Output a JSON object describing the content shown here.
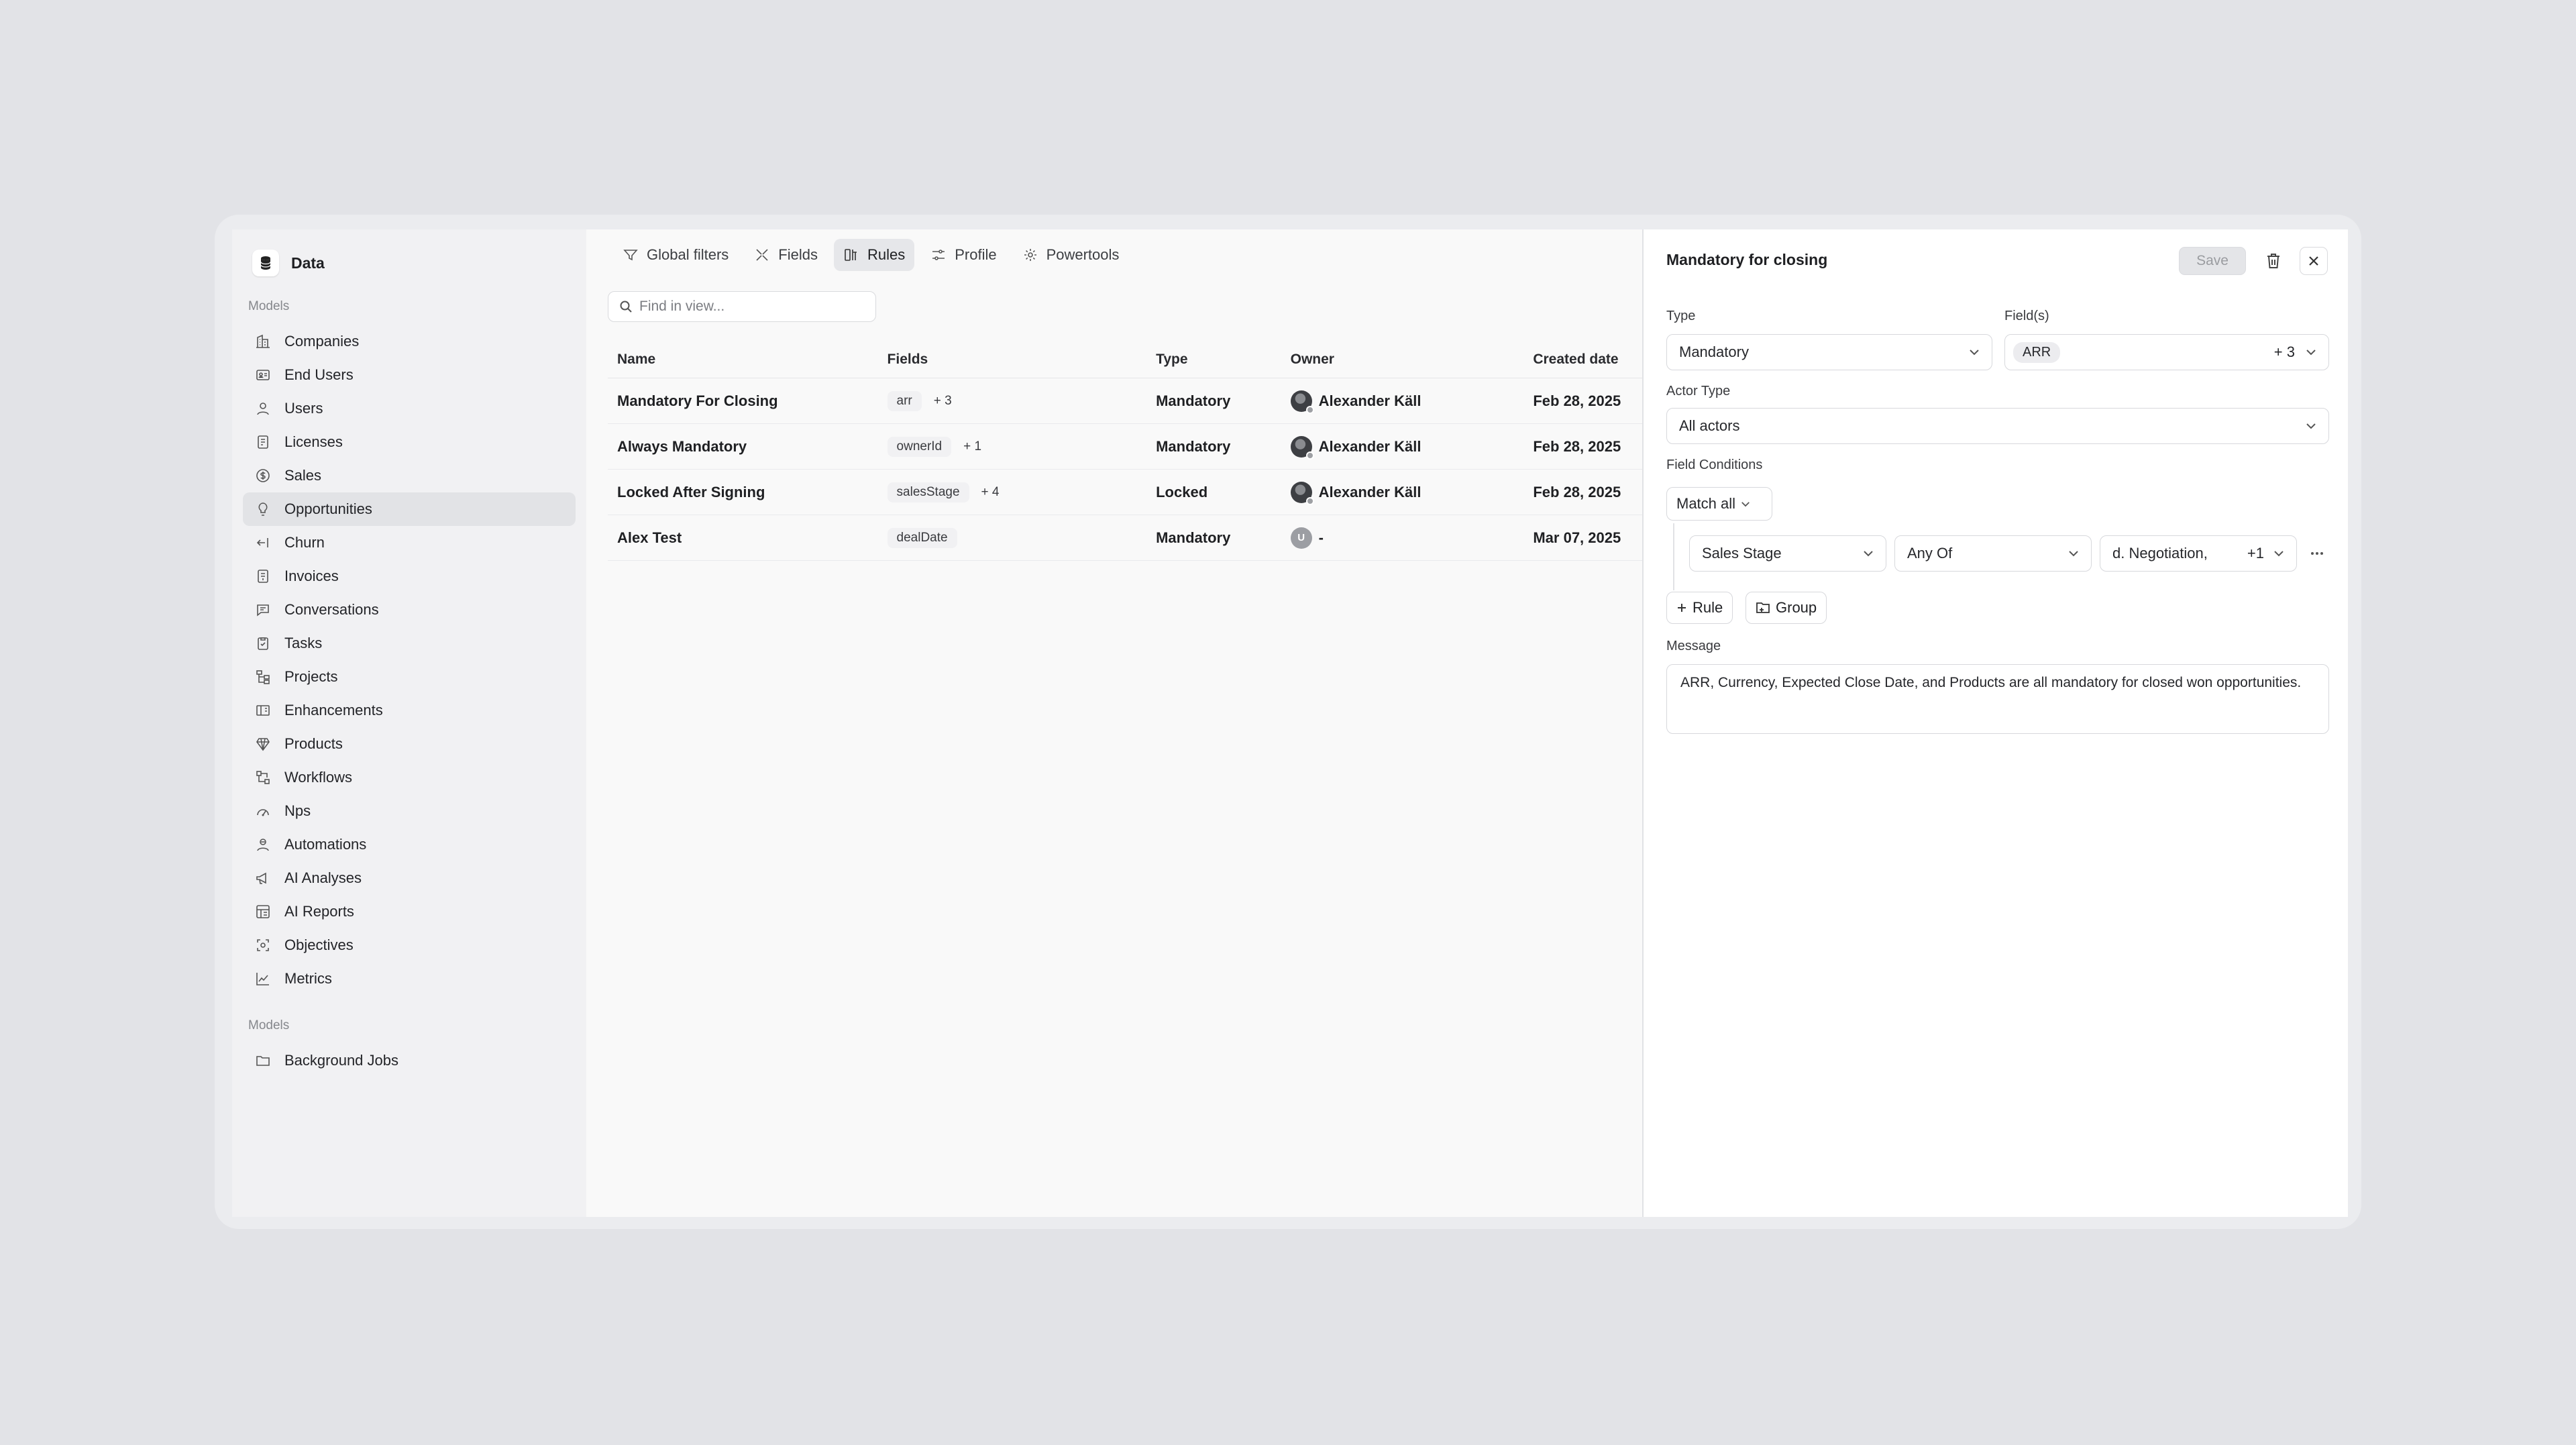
{
  "sidebar": {
    "title": "Data",
    "section_models": "Models",
    "items": [
      {
        "label": "Companies",
        "icon": "building-icon"
      },
      {
        "label": "End Users",
        "icon": "id-card-icon"
      },
      {
        "label": "Users",
        "icon": "user-icon"
      },
      {
        "label": "Licenses",
        "icon": "license-icon"
      },
      {
        "label": "Sales",
        "icon": "dollar-circle-icon"
      },
      {
        "label": "Opportunities",
        "icon": "lightbulb-icon"
      },
      {
        "label": "Churn",
        "icon": "arrow-left-exit-icon"
      },
      {
        "label": "Invoices",
        "icon": "invoice-icon"
      },
      {
        "label": "Conversations",
        "icon": "chat-icon"
      },
      {
        "label": "Tasks",
        "icon": "clipboard-check-icon"
      },
      {
        "label": "Projects",
        "icon": "hierarchy-icon"
      },
      {
        "label": "Enhancements",
        "icon": "columns-icon"
      },
      {
        "label": "Products",
        "icon": "gem-icon"
      },
      {
        "label": "Workflows",
        "icon": "workflow-icon"
      },
      {
        "label": "Nps",
        "icon": "gauge-icon"
      },
      {
        "label": "Automations",
        "icon": "robot-user-icon"
      },
      {
        "label": "AI Analyses",
        "icon": "megaphone-icon"
      },
      {
        "label": "AI Reports",
        "icon": "report-grid-icon"
      },
      {
        "label": "Objectives",
        "icon": "target-icon"
      },
      {
        "label": "Metrics",
        "icon": "line-chart-icon"
      }
    ],
    "active_index": 5,
    "section_models_2": "Models",
    "items_2": [
      {
        "label": "Background Jobs",
        "icon": "folder-icon"
      }
    ]
  },
  "tabs": [
    {
      "label": "Global filters",
      "icon": "filter-icon"
    },
    {
      "label": "Fields",
      "icon": "fields-icon"
    },
    {
      "label": "Rules",
      "icon": "rules-icon"
    },
    {
      "label": "Profile",
      "icon": "sliders-icon"
    },
    {
      "label": "Powertools",
      "icon": "powertools-icon"
    }
  ],
  "active_tab": 2,
  "search": {
    "placeholder": "Find in view..."
  },
  "table": {
    "headers": {
      "name": "Name",
      "fields": "Fields",
      "type": "Type",
      "owner": "Owner",
      "created": "Created date"
    },
    "rows": [
      {
        "name": "Mandatory For Closing",
        "field": "arr",
        "extra": "+ 3",
        "type": "Mandatory",
        "owner": "Alexander Käll",
        "created": "Feb 28, 2025"
      },
      {
        "name": "Always Mandatory",
        "field": "ownerId",
        "extra": "+ 1",
        "type": "Mandatory",
        "owner": "Alexander Käll",
        "created": "Feb 28, 2025"
      },
      {
        "name": "Locked After Signing",
        "field": "salesStage",
        "extra": "+ 4",
        "type": "Locked",
        "owner": "Alexander Käll",
        "created": "Feb 28, 2025"
      },
      {
        "name": "Alex Test",
        "field": "dealDate",
        "extra": "",
        "type": "Mandatory",
        "owner": "-",
        "avatar_letter": "U",
        "created": "Mar 07, 2025"
      }
    ]
  },
  "panel": {
    "title": "Mandatory for closing",
    "save_label": "Save",
    "type_label": "Type",
    "type_value": "Mandatory",
    "fields_label": "Field(s)",
    "fields_tag": "ARR",
    "fields_extra": "+ 3",
    "actor_label": "Actor Type",
    "actor_value": "All actors",
    "conditions_label": "Field Conditions",
    "match_value": "Match all",
    "condition": {
      "field": "Sales Stage",
      "operator": "Any Of",
      "value": "d. Negotiation,",
      "extra": "+1"
    },
    "add_rule_label": "Rule",
    "add_group_label": "Group",
    "message_label": "Message",
    "message_text": "ARR, Currency, Expected Close Date, and Products are all mandatory for closed won opportunities."
  },
  "colors": {
    "background": "#e2e3e7",
    "sidebar": "#f1f1f3",
    "active": "#e2e3e6",
    "panel": "#ffffff"
  }
}
